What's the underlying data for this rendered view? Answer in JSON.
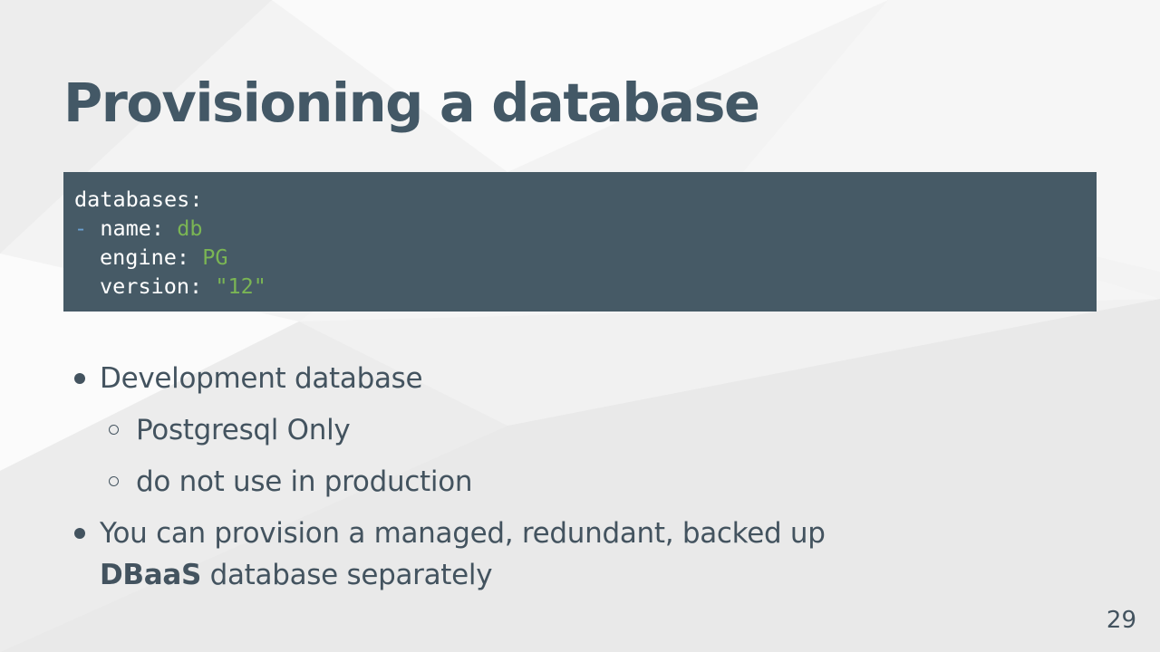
{
  "slide": {
    "title": "Provisioning a database",
    "code": {
      "line1_key": "databases:",
      "line2_dash": "-",
      "line2_key": "name:",
      "line2_val": "db",
      "line3_key": "engine:",
      "line3_val": "PG",
      "line4_key": "version:",
      "line4_val": "\"12\""
    },
    "bullets": {
      "b1": "Development database",
      "b1_sub1": "Postgresql Only",
      "b1_sub2": "do not use in production",
      "b2_line1": "You can provision a managed, redundant, backed up",
      "b2_bold": "DBaaS",
      "b2_rest": " database separately"
    },
    "page_number": "29"
  },
  "colors": {
    "title": "#435866",
    "code_bg": "#465a66",
    "code_key": "#ffffff",
    "code_value": "#7ab554",
    "code_dash": "#6a9fd0",
    "body_text": "#43535f"
  }
}
